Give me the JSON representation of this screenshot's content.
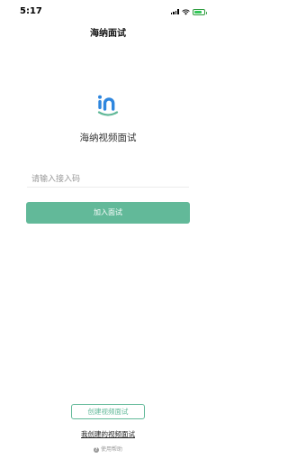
{
  "status_bar": {
    "time": "5:17",
    "icons": [
      "signal-icon",
      "wifi-icon",
      "battery-icon"
    ],
    "battery_color": "#34c759"
  },
  "header": {
    "title": "海纳面试"
  },
  "brand": {
    "logo_text": "in",
    "logo_icon": "hainan-logo-icon",
    "name": "海纳视频面试",
    "logo_color": "#2e86de",
    "smile_color": "#62b999"
  },
  "join_form": {
    "code_placeholder": "请输入接入码",
    "code_value": "",
    "join_label": "加入面试"
  },
  "footer": {
    "create_label": "创建视频面试",
    "my_interviews_label": "我创建的视频面试",
    "help_icon": "help-icon",
    "help_label": "使用帮助"
  },
  "colors": {
    "accent": "#62b999",
    "background": "#ffffff"
  }
}
